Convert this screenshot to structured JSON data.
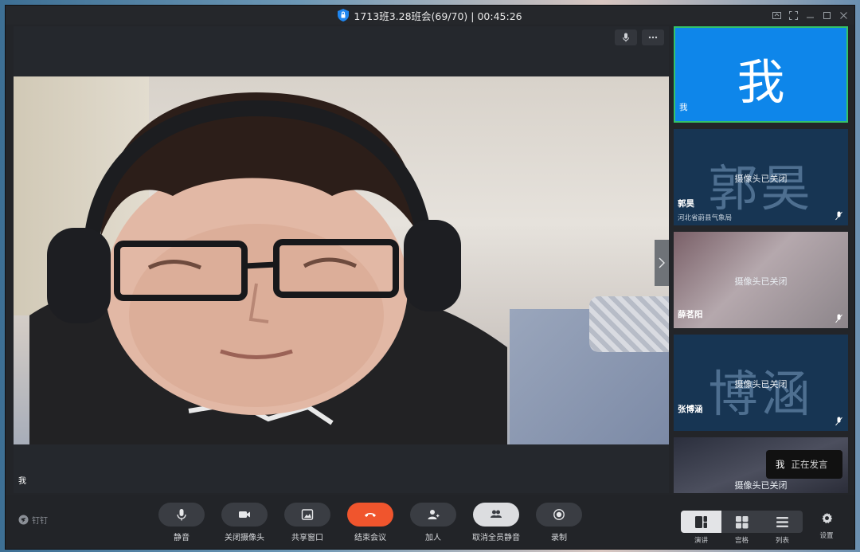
{
  "window": {
    "title": "1713班3.28班会(69/70) | 00:45:26"
  },
  "stage": {
    "speaker_name": "我"
  },
  "participants": [
    {
      "big_char": "我",
      "name": "我",
      "camera_status": "",
      "org": ""
    },
    {
      "big_char": "郭昊",
      "name": "郭昊",
      "camera_status": "摄像头已关闭",
      "org": "河北省蔚县气象局"
    },
    {
      "big_char": "",
      "name": "薛茗阳",
      "camera_status": "摄像头已关闭",
      "org": ""
    },
    {
      "big_char": "博涵",
      "name": "张博涵",
      "camera_status": "摄像头已关闭",
      "org": ""
    },
    {
      "big_char": "",
      "name": "",
      "camera_status": "摄像头已关闭",
      "org": ""
    }
  ],
  "speaking": {
    "who": "我",
    "state": "正在发言"
  },
  "toolbar": {
    "brand": "钉钉",
    "mute": "静音",
    "camera_off": "关闭摄像头",
    "share_window": "共享窗口",
    "end_meeting": "结束会议",
    "add_person": "加人",
    "unmute_all": "取消全员静音",
    "record": "录制",
    "layout_speaker": "演讲",
    "layout_grid": "宫格",
    "layout_list": "列表",
    "settings": "设置"
  },
  "colors": {
    "accent_blue": "#0e86ea",
    "end_red": "#f0552d",
    "active_border": "#34c26a",
    "camera_off_tile": "#173553"
  }
}
